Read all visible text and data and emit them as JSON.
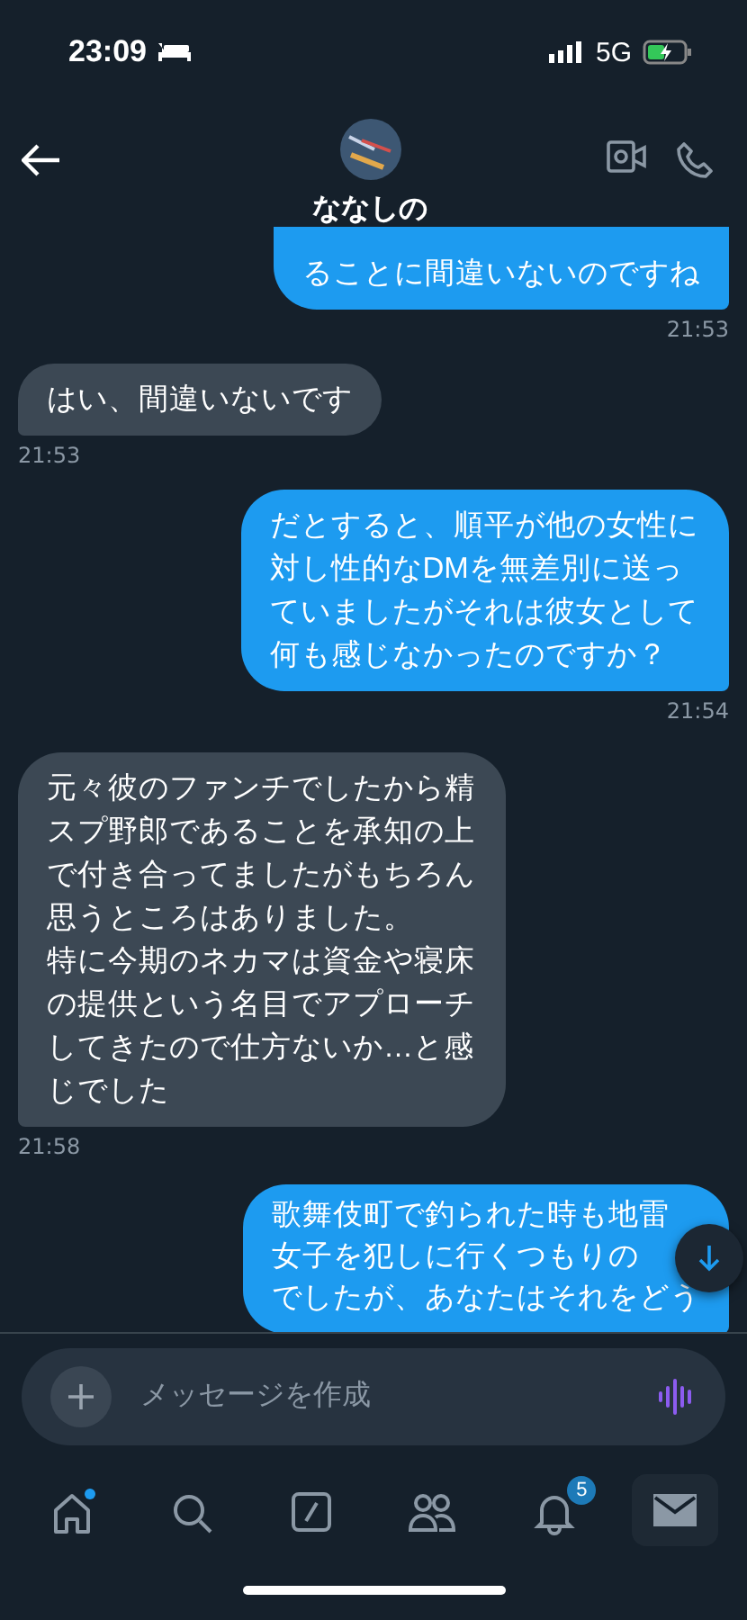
{
  "status_bar": {
    "time": "23:09",
    "network": "5G"
  },
  "header": {
    "name": "ななしの"
  },
  "messages": [
    {
      "kind": "sent",
      "paragraphs": [
        "ることに間違いないのですね"
      ],
      "time": "21:53"
    },
    {
      "kind": "received",
      "paragraphs": [
        "はい、間違いないです"
      ],
      "time": "21:53"
    },
    {
      "kind": "sent",
      "paragraphs": [
        "だとすると、順平が他の女性に対し性的なDMを無差別に送っていましたがそれは彼女として何も感じなかったのですか？"
      ],
      "time": "21:54"
    },
    {
      "kind": "received",
      "paragraphs": [
        "元々彼のファンチでしたから精スプ野郎であることを承知の上で付き合ってましたがもちろん思うところはありました。",
        "特に今期のネカマは資金や寝床の提供という名目でアプローチしてきたので仕方ないか…と感じでした"
      ],
      "time": "21:58"
    },
    {
      "kind": "sent",
      "paragraphs": [
        "歌舞伎町で釣られた時も地雷",
        "女子を犯しに行くつもりの",
        "でしたが、あなたはそれをどう"
      ]
    }
  ],
  "composer": {
    "placeholder": "メッセージを作成"
  },
  "tabs": [
    {
      "kind": "home",
      "selected": false,
      "unread": true
    },
    {
      "kind": "search",
      "selected": false,
      "unread": false
    },
    {
      "kind": "compose",
      "selected": false,
      "unread": false
    },
    {
      "kind": "people",
      "selected": false,
      "unread": false
    },
    {
      "kind": "notifications",
      "selected": false,
      "unread": false,
      "badge": "5"
    },
    {
      "kind": "messages",
      "selected": true,
      "unread": false
    }
  ]
}
